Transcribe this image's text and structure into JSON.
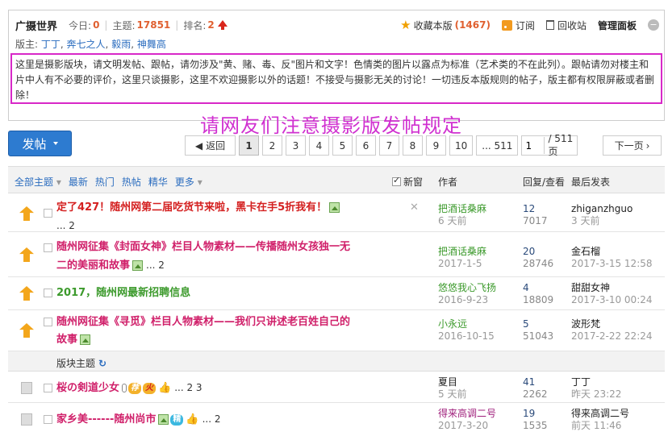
{
  "forum": {
    "title": "广摄世界",
    "today_label": "今日:",
    "today": "0",
    "topics_label": "主题:",
    "topics": "17851",
    "rank_label": "排名:",
    "rank": "2",
    "favorite_label": "收藏本版",
    "favorite_count": "(1467)",
    "subscribe_label": "订阅",
    "recycle_label": "回收站",
    "manage_label": "管理面板",
    "moderators_label": "版主:",
    "moderators": [
      "丁丁",
      "奔七之人",
      "毅雨",
      "神舞高"
    ]
  },
  "rules": "这里是摄影版块，请文明发帖、跟帖，请勿涉及\"黄、赌、毒、反\"图片和文字！色情类的图片以露点为标准（艺术类的不在此列）。跟帖请勿对楼主和片中人有不必要的评价，这里只谈摄影，这里不欢迎摄影以外的话题！不接受与摄影无关的讨论！一切违反本版规则的帖子，版主都有权限屏蔽或者删除！",
  "notice": "请网友们注意摄影版发帖规定",
  "toolbar": {
    "post_label": "发帖",
    "back_label": "返回",
    "pages": [
      "1",
      "2",
      "3",
      "4",
      "5",
      "6",
      "7",
      "8",
      "9",
      "10"
    ],
    "last_page_label": "... 511",
    "page_input": "1",
    "page_total": "/ 511 页",
    "next_label": "下一页"
  },
  "thread_header": {
    "all": "全部主题",
    "latest": "最新",
    "hot": "热门",
    "hot_posts": "热帖",
    "digest": "精华",
    "more": "更多",
    "new_window": "新窗",
    "author": "作者",
    "reply_view": "回复/查看",
    "last_post": "最后发表"
  },
  "sticky_threads": [
    {
      "title": "定了427！随州网第二届吃货节来啦，黑卡在手5折我有！",
      "pages": "... 2",
      "author": "把酒话桑麻",
      "date": "6 天前",
      "replies": "12",
      "views": "7017",
      "last_user": "zhiganzhguo",
      "last_time": "3 天前"
    },
    {
      "title_line1": "随州网征集《封面女神》栏目人物素材——传播随州女孩独一无",
      "title_line2": "二的美丽和故事",
      "pages": "... 2",
      "author": "把酒话桑麻",
      "date": "2017-1-5",
      "replies": "20",
      "views": "28746",
      "last_user": "金石榴",
      "last_time": "2017-3-15 12:58"
    },
    {
      "title": "2017，随州网最新招聘信息",
      "author": "悠悠我心飞扬",
      "date": "2016-9-23",
      "replies": "4",
      "views": "18809",
      "last_user": "甜甜女神",
      "last_time": "2017-3-10 00:24"
    },
    {
      "title_line1": "随州网征集《寻觅》栏目人物素材——我们只讲述老百姓自己的",
      "title_line2": "故事",
      "author": "小永远",
      "date": "2016-10-15",
      "replies": "5",
      "views": "51043",
      "last_user": "波形梵",
      "last_time": "2017-2-22 22:24"
    }
  ],
  "section_label": "版块主题",
  "threads": [
    {
      "title": "桜の剣道少女",
      "tag1": "荐",
      "tag2": "火",
      "pages": "... 2 3",
      "author": "夏目",
      "date": "5 天前",
      "replies": "41",
      "views": "2262",
      "last_user": "丁丁",
      "last_time": "昨天 23:22"
    },
    {
      "title": "家乡美------随州尚市",
      "tag1": "精",
      "pages": "... 2",
      "author": "得来高调二号",
      "date": "2017-3-20",
      "replies": "19",
      "views": "1535",
      "last_user": "得来高调二号",
      "last_time": "前天 11:46"
    }
  ]
}
